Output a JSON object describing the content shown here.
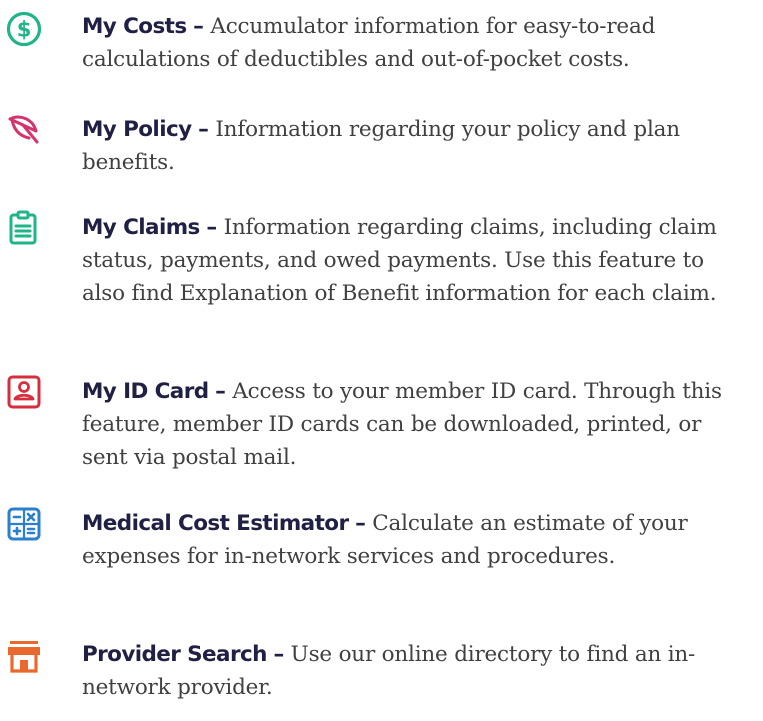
{
  "features": [
    {
      "icon": "dollar-circle-icon",
      "color": "#1fb589",
      "title": "My Costs",
      "dash": "–",
      "description": "Accumulator information for easy-to-read calculations of deductibles and out-of-pocket costs."
    },
    {
      "icon": "umbrella-icon",
      "color": "#d6336c",
      "title": "My Policy",
      "dash": "–",
      "description": "Information regarding your policy and plan benefits."
    },
    {
      "icon": "clipboard-icon",
      "color": "#1fb589",
      "title": "My Claims",
      "dash": "–",
      "description": "Information regarding claims, including claim status, payments, and owed payments. Use this feature to also find Explanation of Benefit information for each claim."
    },
    {
      "icon": "id-card-icon",
      "color": "#d62e3c",
      "title": "My ID Card",
      "dash": "–",
      "description": "Access to your member ID card. Through this feature, member ID cards can be downloaded, printed, or sent via postal mail."
    },
    {
      "icon": "calculator-icon",
      "color": "#2a7fcf",
      "title": "Medical Cost Estimator",
      "dash": "–",
      "description": "Calculate an estimate of your expenses for in-network services and procedures."
    },
    {
      "icon": "storefront-icon",
      "color": "#e8692b",
      "title": "Provider Search",
      "dash": "–",
      "description": "Use our online directory to find an in-network provider."
    }
  ]
}
